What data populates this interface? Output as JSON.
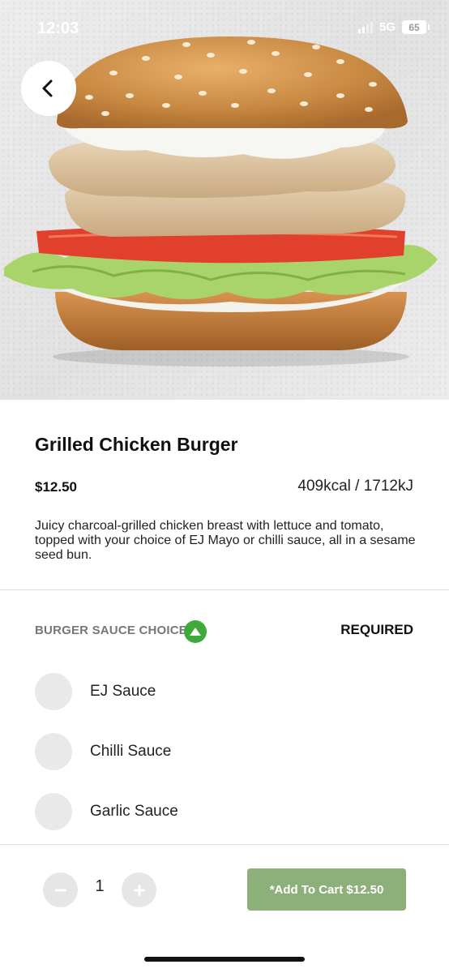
{
  "status_bar": {
    "time": "12:03",
    "network": "5G",
    "battery": "65"
  },
  "hero": {
    "image_description": "photo",
    "back_icon": "chevron-left-icon"
  },
  "product": {
    "name": "Grilled Chicken Burger",
    "price": "$12.50",
    "energy": "409kcal / 1712kJ",
    "description": "Juicy charcoal-grilled chicken breast with lettuce and tomato, topped with your choice of EJ Mayo or chilli sauce, all in a sesame seed bun."
  },
  "sauce_section": {
    "title": "BURGER SAUCE CHOICE",
    "toggle_icon": "chevron-up-icon",
    "toggle_color": "#3eaa3a",
    "requirement": "REQUIRED",
    "options": [
      {
        "label": "EJ Sauce",
        "selected": false
      },
      {
        "label": "Chilli Sauce",
        "selected": false
      },
      {
        "label": "Garlic Sauce",
        "selected": false
      }
    ]
  },
  "footer": {
    "quantity": "1",
    "decrement_icon": "minus-icon",
    "increment_icon": "plus-icon",
    "add_to_cart_label": "*Add To Cart $12.50",
    "add_to_cart_color": "#8db07a"
  }
}
